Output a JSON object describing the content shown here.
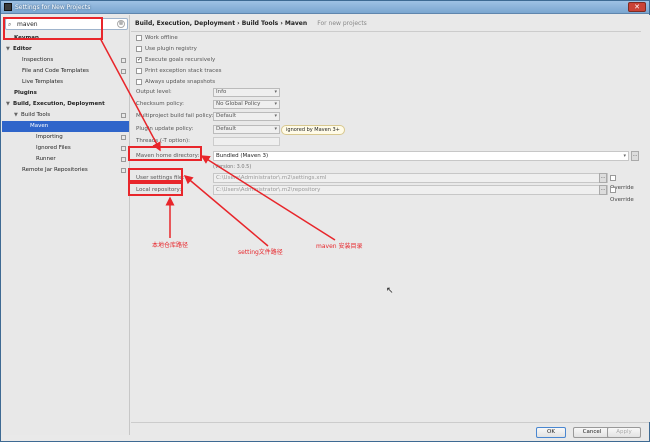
{
  "window": {
    "title": "Settings for New Projects",
    "close_label": "✕"
  },
  "search": {
    "value": "maven",
    "icon": "search-icon",
    "clear": "⊗"
  },
  "sidebar": {
    "items": [
      {
        "label": "Keymap",
        "bold": true
      },
      {
        "label": "Editor",
        "bold": true,
        "expanded": true
      },
      {
        "label": "Inspections"
      },
      {
        "label": "File and Code Templates"
      },
      {
        "label": "Live Templates"
      },
      {
        "label": "Plugins",
        "bold": true
      },
      {
        "label": "Build, Execution, Deployment",
        "bold": true,
        "expanded": true
      },
      {
        "label": "Build Tools",
        "expanded": true
      },
      {
        "label": "Maven",
        "selected": true
      },
      {
        "label": "Importing"
      },
      {
        "label": "Ignored Files"
      },
      {
        "label": "Runner"
      },
      {
        "label": "Remote Jar Repositories"
      }
    ]
  },
  "breadcrumb": {
    "path": "Build, Execution, Deployment › Build Tools › Maven",
    "note": "For new projects"
  },
  "checkboxes": [
    {
      "label": "Work offline",
      "checked": false
    },
    {
      "label": "Use plugin registry",
      "checked": false
    },
    {
      "label": "Execute goals recursively",
      "checked": true
    },
    {
      "label": "Print exception stack traces",
      "checked": false
    },
    {
      "label": "Always update snapshots",
      "checked": false
    }
  ],
  "fields": {
    "output_level": {
      "label": "Output level:",
      "value": "Info"
    },
    "checksum_policy": {
      "label": "Checksum policy:",
      "value": "No Global Policy"
    },
    "multiproject_fail": {
      "label": "Multiproject build fail policy:",
      "value": "Default"
    },
    "plugin_update": {
      "label": "Plugin update policy:",
      "value": "Default",
      "badge": "ignored by Maven 3+"
    },
    "threads": {
      "label": "Threads (-T option):",
      "value": ""
    },
    "maven_home": {
      "label": "Maven home directory:",
      "value": "Bundled (Maven 3)",
      "version": "(Version: 3.0.5)"
    },
    "user_settings": {
      "label": "User settings file:",
      "value": "C:\\Users\\Administrator\\.m2\\settings.xml",
      "override": "Override"
    },
    "local_repo": {
      "label": "Local repository:",
      "value": "C:\\Users\\Administrator\\.m2\\repository",
      "override": "Override"
    }
  },
  "annotations": {
    "local_repo_path": "本地仓库路径",
    "settings_path": "setting文件路径",
    "maven_dir": "maven 安装目录"
  },
  "footer": {
    "ok": "OK",
    "cancel": "Cancel",
    "apply": "Apply"
  },
  "colors": {
    "annotation": "#e8262b",
    "selection": "#2f65ca"
  }
}
